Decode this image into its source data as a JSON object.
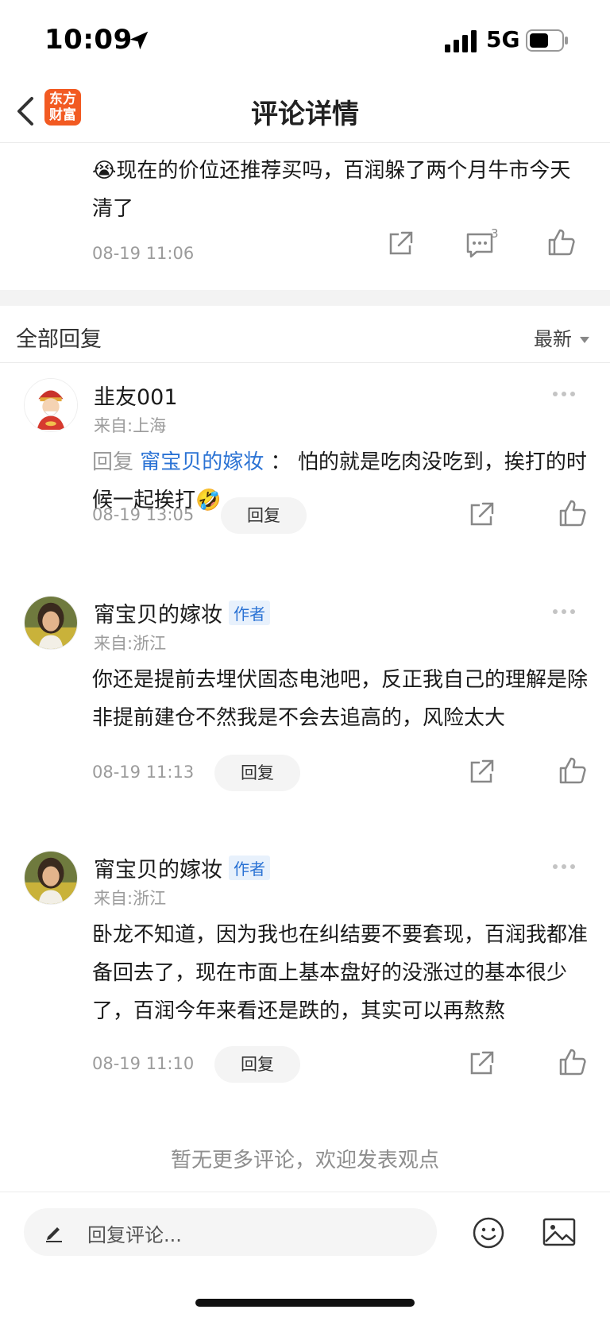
{
  "status_bar": {
    "time": "10:09",
    "network": "5G",
    "battery_level": 0.6
  },
  "nav": {
    "title": "评论详情",
    "app_logo_text": "东方财富"
  },
  "main_comment": {
    "text": "😭现在的价位还推荐买吗，百润躲了两个月牛市今天清了",
    "time": "08-19 11:06",
    "reply_count": "3"
  },
  "replies_header": {
    "title": "全部回复",
    "sort": "最新"
  },
  "replies": [
    {
      "user": "韭友001",
      "location": "来自:上海",
      "is_author": false,
      "prefix": "回复 ",
      "target": "甯宝贝的嫁妆",
      "sep": " ： ",
      "text": "怕的就是吃肉没吃到，挨打的时候一起挨打🤣",
      "time": "08-19 13:05",
      "reply_label": "回复"
    },
    {
      "user": "甯宝贝的嫁妆",
      "location": "来自:浙江",
      "is_author": true,
      "author_badge": "作者",
      "text": "你还是提前去埋伏固态电池吧，反正我自己的理解是除非提前建仓不然我是不会去追高的，风险太大",
      "time": "08-19 11:13",
      "reply_label": "回复"
    },
    {
      "user": "甯宝贝的嫁妆",
      "location": "来自:浙江",
      "is_author": true,
      "author_badge": "作者",
      "text": "卧龙不知道，因为我也在纠结要不要套现，百润我都准备回去了，现在市面上基本盘好的没涨过的基本很少了，百润今年来看还是跌的，其实可以再熬熬",
      "time": "08-19 11:10",
      "reply_label": "回复"
    }
  ],
  "end_message": "暂无更多评论，欢迎发表观点",
  "input": {
    "placeholder": "回复评论..."
  },
  "colors": {
    "brand": "#f25a22",
    "link": "#2a72d4",
    "muted": "#9b9b9b"
  }
}
